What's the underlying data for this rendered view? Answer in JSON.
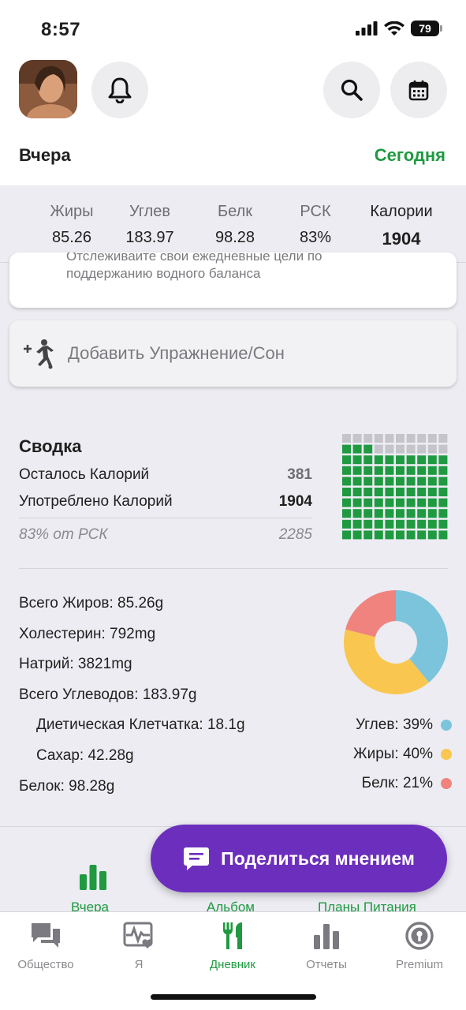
{
  "status_bar": {
    "time": "8:57",
    "battery": "79"
  },
  "header": {
    "prev_day": "Вчера",
    "next_day": "Сегодня"
  },
  "macros": [
    {
      "label": "Жиры",
      "value": "85.26"
    },
    {
      "label": "Углев",
      "value": "183.97"
    },
    {
      "label": "Белк",
      "value": "98.28"
    },
    {
      "label": "РСК",
      "value": "83%"
    },
    {
      "label": "Калории",
      "value": "1904"
    }
  ],
  "water_card": {
    "text_line1": "Отслеживайте свои ежедневные цели по",
    "text_line2": "поддержанию водного баланса"
  },
  "add_exercise": {
    "label": "Добавить Упражнение/Сон"
  },
  "summary": {
    "title": "Сводка",
    "remaining_label": "Осталось Калорий",
    "remaining_value": "381",
    "consumed_label": "Употреблено Калорий",
    "consumed_value": "1904",
    "rdi_label": "83% от РСК",
    "rdi_value": "2285",
    "waffle_fill_fraction": 0.83
  },
  "nutrients": [
    "Всего Жиров: 85.26g",
    "Холестерин: 792mg",
    "Натрий: 3821mg",
    "Всего Углеводов: 183.97g",
    "Диетическая Клетчатка: 18.1g",
    "Сахар: 42.28g",
    "Белок: 98.28g"
  ],
  "chart_data": {
    "type": "pie",
    "categories": [
      "Углев",
      "Жиры",
      "Белк"
    ],
    "values": [
      39,
      40,
      21
    ],
    "colors": [
      "#7cc4dc",
      "#f9c74f",
      "#f0837e"
    ],
    "legend": [
      "Углев: 39%",
      "Жиры: 40%",
      "Белк: 21%"
    ]
  },
  "subtabs": [
    {
      "label": "Вчера",
      "icon": "bar-chart-icon"
    },
    {
      "label": "Альбом",
      "icon": "album-icon"
    },
    {
      "label": "Планы Питания",
      "icon": "meal-plan-icon"
    }
  ],
  "feedback_button": {
    "label": "Поделиться мнением",
    "icon": "chat-bubble-icon"
  },
  "bottom_nav": [
    {
      "label": "Общество",
      "icon": "community-icon"
    },
    {
      "label": "Я",
      "icon": "health-icon"
    },
    {
      "label": "Дневник",
      "icon": "fork-knife-icon"
    },
    {
      "label": "Отчеты",
      "icon": "reports-icon"
    },
    {
      "label": "Premium",
      "icon": "premium-badge-icon"
    }
  ],
  "colors": {
    "accent_green": "#1f9a41",
    "fab_purple": "#6c2fbd",
    "waffle_gray": "#c4c4ca"
  }
}
